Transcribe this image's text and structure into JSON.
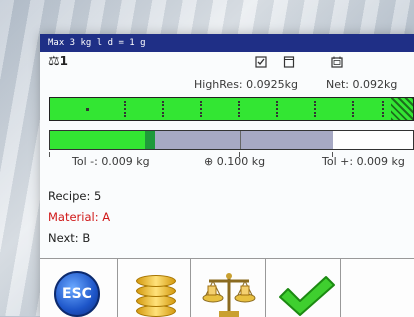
{
  "screen": {
    "capacity_text": "Max 3 kg  l d = 1 g",
    "scale_number": "1",
    "icons": [
      "scale-icon",
      "checkbox-icon",
      "document-icon",
      "calendar-icon"
    ]
  },
  "weight": {
    "highres_label": "HighRes:",
    "highres_value": "0.0925kg",
    "net_label": "Net:",
    "net_value": "0.092kg"
  },
  "tolerance": {
    "minus_label": "Tol -:",
    "minus_value": "0.009 kg",
    "target_symbol": "⊕",
    "target_value": "0.100 kg",
    "plus_label": "Tol +:",
    "plus_value": "0.009 kg"
  },
  "recipe": {
    "recipe_label": "Recipe:",
    "recipe_value": "5",
    "material_label": "Material:",
    "material_value": "A",
    "next_label": "Next:",
    "next_value": "B"
  },
  "toolbar": {
    "esc_label": "ESC",
    "buttons": [
      "esc-button",
      "database-button",
      "balance-button",
      "confirm-button"
    ]
  },
  "colors": {
    "header": "#1f2f86",
    "bar_green": "#33e633",
    "tol_gray": "#a7a9c4",
    "material_red": "#d01818"
  }
}
